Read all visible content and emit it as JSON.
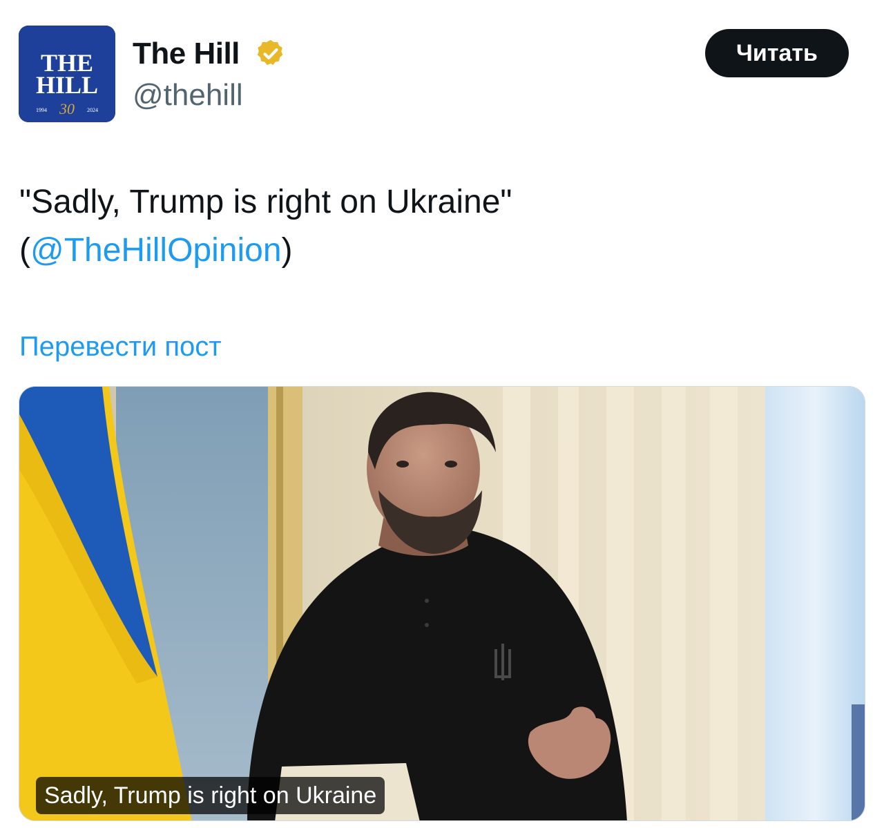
{
  "post": {
    "author": {
      "name": "The Hill",
      "handle": "@thehill",
      "verified_badge_icon": "verified-badge-icon",
      "verified_badge_color": "#e8b829",
      "avatar": {
        "line1": "THE",
        "line2": "HILL",
        "year_start": "1994",
        "anniversary": "30",
        "year_end": "2024",
        "background": "#1e3f9a",
        "accent": "#d4a93c"
      }
    },
    "read_button_label": "Читать",
    "text": {
      "line1": "\"Sadly, Trump is right on Ukraine\"",
      "open_paren": "(",
      "mention": "@TheHillOpinion",
      "close_paren": ")"
    },
    "translate_label": "Перевести пост",
    "card": {
      "caption": "Sadly, Trump is right on Ukraine"
    }
  },
  "colors": {
    "text_primary": "#0f1419",
    "text_secondary": "#536471",
    "link": "#1d9bf0",
    "button_bg": "#0f1419",
    "button_text": "#ffffff"
  }
}
